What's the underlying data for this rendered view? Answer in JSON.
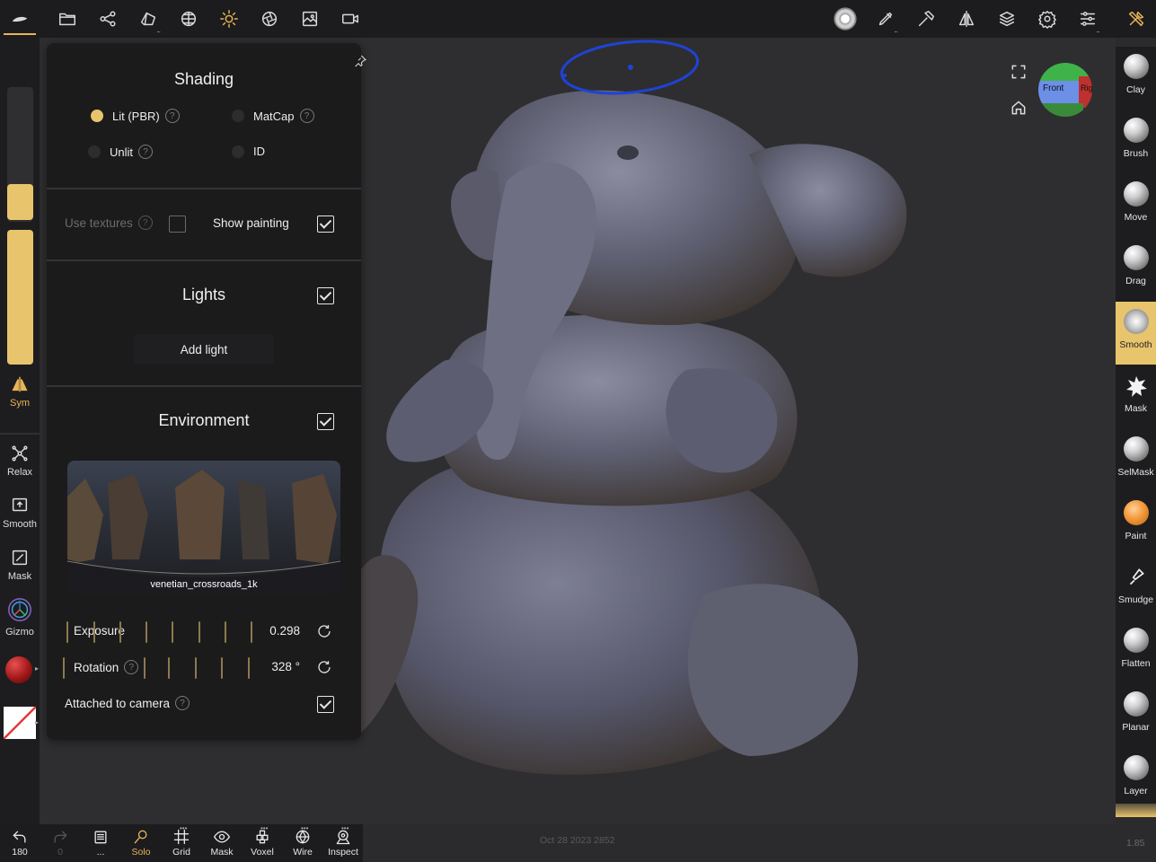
{
  "topbar": {
    "icons": [
      "nomad-logo-icon",
      "folder-icon",
      "scene-graph-icon",
      "topology-icon",
      "material-sphere-icon",
      "sun-icon",
      "lens-icon",
      "image-icon",
      "camera-icon"
    ],
    "right_icons": [
      "brush-preview-icon",
      "paint-brush-icon",
      "hammer-icon",
      "symmetry-icon",
      "layers-icon",
      "settings-icon",
      "sliders-icon",
      "tools-icon"
    ]
  },
  "left_toolbar": {
    "items": [
      {
        "label": "Sym",
        "icon": "symmetry-icon"
      },
      {
        "label": "Relax",
        "icon": "relax-icon"
      },
      {
        "label": "Smooth",
        "icon": "smooth-icon"
      },
      {
        "label": "Mask",
        "icon": "mask-icon"
      },
      {
        "label": "Gizmo",
        "icon": "gizmo-icon"
      }
    ]
  },
  "panel": {
    "shading": {
      "title": "Shading",
      "options": [
        {
          "label": "Lit (PBR)",
          "selected": true,
          "help": true
        },
        {
          "label": "MatCap",
          "selected": false,
          "help": true
        },
        {
          "label": "Unlit",
          "selected": false,
          "help": true
        },
        {
          "label": "ID",
          "selected": false,
          "help": false
        }
      ],
      "use_textures_label": "Use textures",
      "show_painting_label": "Show painting"
    },
    "lights": {
      "title": "Lights",
      "add_label": "Add light"
    },
    "environment": {
      "title": "Environment",
      "thumbnail_caption": "venetian_crossroads_1k",
      "exposure_label": "Exposure",
      "exposure_value": "0.298",
      "rotation_label": "Rotation",
      "rotation_value": "328 °",
      "attached_label": "Attached to camera"
    },
    "help_glyph": "?"
  },
  "right_toolbar": {
    "tools": [
      {
        "label": "Clay",
        "active": false
      },
      {
        "label": "Brush",
        "active": false
      },
      {
        "label": "Move",
        "active": false
      },
      {
        "label": "Drag",
        "active": false
      },
      {
        "label": "Smooth",
        "active": true
      },
      {
        "label": "Mask",
        "active": false
      },
      {
        "label": "SelMask",
        "active": false
      },
      {
        "label": "Paint",
        "active": false
      },
      {
        "label": "Smudge",
        "active": false
      },
      {
        "label": "Flatten",
        "active": false
      },
      {
        "label": "Planar",
        "active": false
      },
      {
        "label": "Layer",
        "active": false
      }
    ]
  },
  "bottom_toolbar": {
    "items": [
      {
        "label": "180",
        "icon": "undo-icon"
      },
      {
        "label": "0",
        "icon": "redo-icon"
      },
      {
        "label": "...",
        "icon": "history-icon"
      },
      {
        "label": "Solo",
        "icon": "solo-icon"
      },
      {
        "label": "Grid",
        "icon": "grid-icon"
      },
      {
        "label": "Mask",
        "icon": "eye-icon"
      },
      {
        "label": "Voxel",
        "icon": "voxel-icon"
      },
      {
        "label": "Wire",
        "icon": "wireframe-icon"
      },
      {
        "label": "Inspect",
        "icon": "inspect-icon"
      }
    ]
  },
  "navcube": {
    "front_label": "Front",
    "right_label": "Rig"
  },
  "watermark": "Oct 28 2023 2852",
  "version": "1.85",
  "colors": {
    "accent": "#e8c46c",
    "panel_bg": "#1b1b1c",
    "viewport_bg": "#2e2e30",
    "model": "#6b6b80"
  }
}
